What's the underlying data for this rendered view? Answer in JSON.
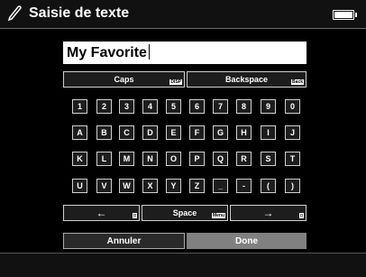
{
  "header": {
    "title": "Saisie de texte",
    "icon": "pen-icon",
    "battery_icon": "battery-icon"
  },
  "input": {
    "value": "My Favorite"
  },
  "keys_top": {
    "caps": {
      "label": "Caps",
      "tag": "DISP"
    },
    "backspace": {
      "label": "Backspace",
      "tag": "Back"
    }
  },
  "keys_rows": [
    [
      "1",
      "2",
      "3",
      "4",
      "5",
      "6",
      "7",
      "8",
      "9",
      "0"
    ],
    [
      "A",
      "B",
      "C",
      "D",
      "E",
      "F",
      "G",
      "H",
      "I",
      "J"
    ],
    [
      "K",
      "L",
      "M",
      "N",
      "O",
      "P",
      "Q",
      "R",
      "S",
      "T"
    ],
    [
      "U",
      "V",
      "W",
      "X",
      "Y",
      "Z",
      "_",
      "-",
      "(",
      ")"
    ]
  ],
  "keys_bottom": {
    "left": {
      "label": "←",
      "tag": "◘"
    },
    "space": {
      "label": "Space",
      "tag": "Menu"
    },
    "right": {
      "label": "→",
      "tag": "◘"
    }
  },
  "actions": {
    "cancel": {
      "label": "Annuler"
    },
    "done": {
      "label": "Done"
    }
  },
  "colors": {
    "done_bg": "#808080",
    "cancel_bg": "#2a2a2a"
  }
}
